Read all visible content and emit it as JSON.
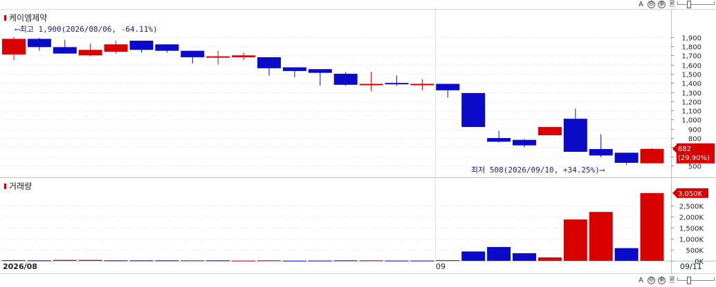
{
  "toolbar": {
    "buttons": [
      "A",
      "⊖",
      "⊕",
      "🖹"
    ]
  },
  "price_pane": {
    "title": "케이엠제약",
    "high_annotation": "⟵최고 1,900(2026/08/06, -64.11%)",
    "low_annotation": "최저 508(2026/09/10, +34.25%)⟶",
    "current_price_label": "682",
    "current_change_label": "(29.90%)"
  },
  "volume_pane": {
    "title": "거래량",
    "current_volume_label": "3,050K"
  },
  "x_axis": {
    "start_label": "2026/08",
    "mid_label": "09",
    "end_label": "09/11"
  },
  "colors": {
    "up": "#d90000",
    "down": "#0a0ac8",
    "grid": "#dde2e8",
    "axis_bg": "#ffffff"
  },
  "chart_data": [
    {
      "type": "candlestick",
      "title": "케이엠제약",
      "ylim": [
        500,
        1950
      ],
      "y_ticks": [
        500,
        600,
        700,
        800,
        900,
        1000,
        1100,
        1200,
        1300,
        1400,
        1500,
        1600,
        1700,
        1800,
        1900
      ],
      "y_tick_labels": [
        "500",
        "600",
        "700",
        "800",
        "900",
        "1,000",
        "1,100",
        "1,200",
        "1,300",
        "1,400",
        "1,500",
        "1,600",
        "1,700",
        "1,800",
        "1,900"
      ],
      "candles": [
        {
          "o": 1710,
          "h": 1900,
          "l": 1650,
          "c": 1880
        },
        {
          "o": 1880,
          "h": 1890,
          "l": 1750,
          "c": 1790
        },
        {
          "o": 1790,
          "h": 1870,
          "l": 1720,
          "c": 1720
        },
        {
          "o": 1700,
          "h": 1830,
          "l": 1690,
          "c": 1760
        },
        {
          "o": 1740,
          "h": 1860,
          "l": 1720,
          "c": 1820
        },
        {
          "o": 1860,
          "h": 1860,
          "l": 1730,
          "c": 1760
        },
        {
          "o": 1820,
          "h": 1820,
          "l": 1730,
          "c": 1750
        },
        {
          "o": 1750,
          "h": 1750,
          "l": 1610,
          "c": 1680
        },
        {
          "o": 1690,
          "h": 1750,
          "l": 1600,
          "c": 1690
        },
        {
          "o": 1680,
          "h": 1730,
          "l": 1650,
          "c": 1700
        },
        {
          "o": 1680,
          "h": 1680,
          "l": 1480,
          "c": 1560
        },
        {
          "o": 1570,
          "h": 1570,
          "l": 1460,
          "c": 1530
        },
        {
          "o": 1550,
          "h": 1550,
          "l": 1370,
          "c": 1510
        },
        {
          "o": 1500,
          "h": 1520,
          "l": 1370,
          "c": 1380
        },
        {
          "o": 1380,
          "h": 1520,
          "l": 1310,
          "c": 1390
        },
        {
          "o": 1400,
          "h": 1480,
          "l": 1370,
          "c": 1390
        },
        {
          "o": 1390,
          "h": 1440,
          "l": 1320,
          "c": 1390
        },
        {
          "o": 1390,
          "h": 1390,
          "l": 1240,
          "c": 1320
        },
        {
          "o": 1290,
          "h": 1290,
          "l": 920,
          "c": 920
        },
        {
          "o": 800,
          "h": 880,
          "l": 750,
          "c": 760
        },
        {
          "o": 780,
          "h": 790,
          "l": 700,
          "c": 720
        },
        {
          "o": 830,
          "h": 920,
          "l": 830,
          "c": 920
        },
        {
          "o": 1010,
          "h": 1120,
          "l": 650,
          "c": 650
        },
        {
          "o": 680,
          "h": 840,
          "l": 590,
          "c": 610
        },
        {
          "o": 640,
          "h": 640,
          "l": 508,
          "c": 530
        },
        {
          "o": 525,
          "h": 690,
          "l": 525,
          "c": 682
        }
      ]
    },
    {
      "type": "bar",
      "title": "거래량",
      "ylim": [
        0,
        3200
      ],
      "y_ticks": [
        0,
        500,
        1000,
        1500,
        2000,
        2500
      ],
      "y_tick_labels": [
        "0K",
        "500K",
        "1,000K",
        "1,500K",
        "2,000K",
        "2,500K"
      ],
      "values": [
        30,
        20,
        40,
        40,
        20,
        20,
        20,
        20,
        20,
        10,
        20,
        5,
        10,
        20,
        20,
        10,
        10,
        30,
        420,
        620,
        340,
        150,
        1860,
        2200,
        570,
        3050
      ],
      "up": [
        true,
        false,
        true,
        true,
        false,
        false,
        false,
        true,
        false,
        true,
        true,
        false,
        false,
        false,
        true,
        false,
        false,
        true,
        false,
        false,
        false,
        true,
        true,
        true,
        false,
        true
      ]
    }
  ]
}
